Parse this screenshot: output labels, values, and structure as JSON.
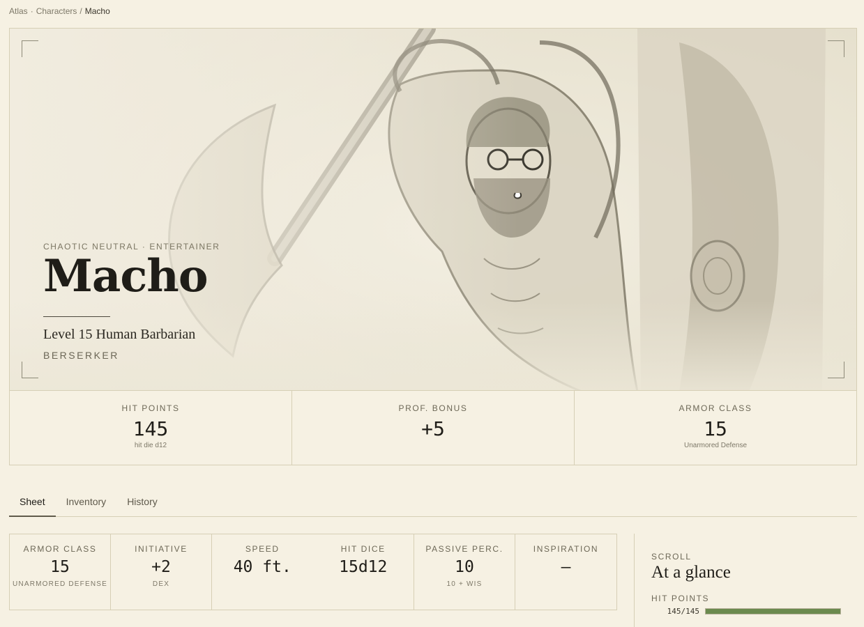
{
  "breadcrumb": {
    "root": "Atlas",
    "section": "Characters",
    "current": "Macho"
  },
  "hero": {
    "eyebrow": "CHAOTIC NEUTRAL · ENTERTAINER",
    "name": "Macho",
    "class_line": "Level 15 Human Barbarian",
    "subclass": "BERSERKER",
    "art_icon": "barbarian-portrait-sketch"
  },
  "stats": {
    "hp": {
      "label": "HIT POINTS",
      "value": "145",
      "note": "hit die d12"
    },
    "prof": {
      "label": "PROF. BONUS",
      "value": "+5",
      "note": ""
    },
    "ac": {
      "label": "ARMOR CLASS",
      "value": "15",
      "note": "Unarmored Defense"
    }
  },
  "tabs": [
    {
      "label": "Sheet",
      "active": true
    },
    {
      "label": "Inventory",
      "active": false
    },
    {
      "label": "History",
      "active": false
    }
  ],
  "attributes": {
    "armor_class": {
      "label": "ARMOR CLASS",
      "value": "15",
      "note": "UNARMORED DEFENSE"
    },
    "initiative": {
      "label": "INITIATIVE",
      "value": "+2",
      "note": "DEX"
    },
    "speed": {
      "label": "SPEED",
      "value": "40 ft.",
      "note": ""
    },
    "hit_dice": {
      "label": "HIT DICE",
      "value": "15d12",
      "note": ""
    },
    "passive": {
      "label": "PASSIVE PERC.",
      "value": "10",
      "note": "10 + WIS"
    },
    "inspiration": {
      "label": "INSPIRATION",
      "value": "—",
      "note": ""
    }
  },
  "side": {
    "eyebrow": "SCROLL",
    "title": "At a glance",
    "hp_label": "HIT POINTS",
    "hp_text": "145/145",
    "hp_fraction": 1.0,
    "hp_color": "#6b8a4e"
  }
}
